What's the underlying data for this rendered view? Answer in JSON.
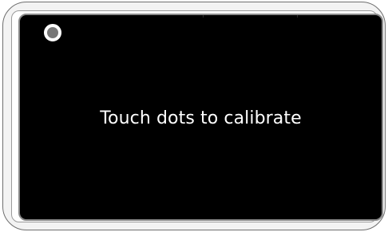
{
  "calibration": {
    "message": "Touch dots to calibrate",
    "active_dot": "top-left"
  },
  "colors": {
    "screen_background": "#000000",
    "text": "#ffffff",
    "dot_fill": "#777777",
    "dot_ring": "#ffffff",
    "frame": "#6f6f6f"
  }
}
